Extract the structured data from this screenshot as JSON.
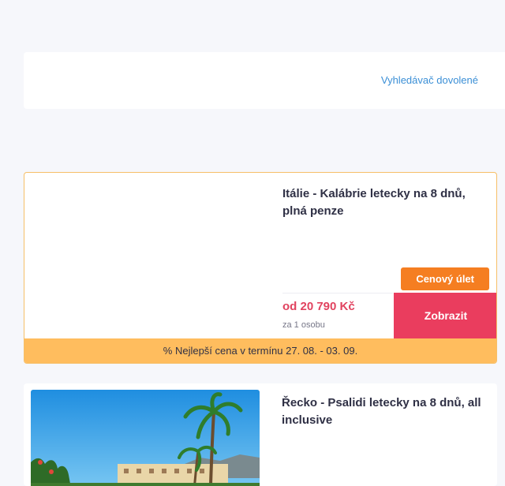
{
  "header": {
    "search_link": "Vyhledávač dovolené"
  },
  "offers": [
    {
      "title": "Itálie - Kalábrie letecky na 8 dnů, plná penze",
      "badge": "Cenový úlet",
      "price": "od 20 790 Kč",
      "price_note": "za 1 osobu",
      "cta_label": "Zobrazit",
      "promo": "% Nejlepší cena v termínu 27. 08. - 03. 09."
    },
    {
      "title": "Řecko - Psalidi letecky na 8 dnů, all inclusive"
    }
  ],
  "colors": {
    "accent_orange": "#f57e21",
    "cta_red": "#ea3d5e",
    "price_red": "#e1435f",
    "promo_band": "#ffbd5e",
    "link_blue": "#3b8fd6"
  }
}
